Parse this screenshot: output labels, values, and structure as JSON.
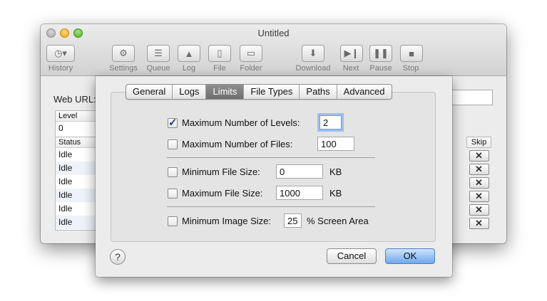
{
  "window": {
    "title": "Untitled",
    "toolbar": [
      {
        "label": "History",
        "icon": "history-icon"
      },
      {
        "label": "Settings",
        "icon": "gear-icon"
      },
      {
        "label": "Queue",
        "icon": "list-icon"
      },
      {
        "label": "Log",
        "icon": "warning-icon"
      },
      {
        "label": "File",
        "icon": "document-icon"
      },
      {
        "label": "Folder",
        "icon": "folder-icon"
      },
      {
        "label": "Download",
        "icon": "download-icon"
      },
      {
        "label": "Next",
        "icon": "next-icon"
      },
      {
        "label": "Pause",
        "icon": "pause-icon"
      },
      {
        "label": "Stop",
        "icon": "stop-icon"
      }
    ]
  },
  "main": {
    "web_url_label": "Web URL:",
    "level_header": "Level",
    "level_value": "0",
    "status_header": "Status",
    "skip_header": "Skip",
    "status_rows": [
      "Idle",
      "Idle",
      "Idle",
      "Idle",
      "Idle",
      "Idle"
    ],
    "skip_glyph": "✕"
  },
  "dialog": {
    "tabs": [
      "General",
      "Logs",
      "Limits",
      "File Types",
      "Paths",
      "Advanced"
    ],
    "selected_tab": "Limits",
    "max_levels": {
      "label": "Maximum Number of Levels:",
      "checked": true,
      "value": "2"
    },
    "max_files": {
      "label": "Maximum Number of Files:",
      "checked": false,
      "value": "100"
    },
    "min_file_size": {
      "label": "Minimum File Size:",
      "checked": false,
      "value": "0",
      "unit": "KB"
    },
    "max_file_size": {
      "label": "Maximum File Size:",
      "checked": false,
      "value": "1000",
      "unit": "KB"
    },
    "min_image_size": {
      "label": "Minimum Image Size:",
      "checked": false,
      "value": "25",
      "unit": "% Screen Area"
    },
    "help_label": "?",
    "cancel_label": "Cancel",
    "ok_label": "OK"
  },
  "colors": {
    "accent": "#6fa8ec",
    "focus_ring": "#9cc0ef"
  }
}
